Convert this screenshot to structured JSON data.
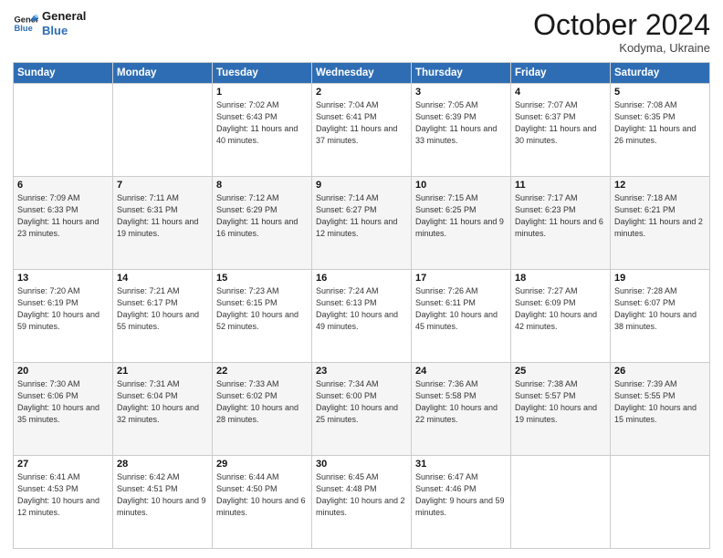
{
  "header": {
    "logo_line1": "General",
    "logo_line2": "Blue",
    "month": "October 2024",
    "location": "Kodyma, Ukraine"
  },
  "weekdays": [
    "Sunday",
    "Monday",
    "Tuesday",
    "Wednesday",
    "Thursday",
    "Friday",
    "Saturday"
  ],
  "weeks": [
    [
      {
        "day": "",
        "info": ""
      },
      {
        "day": "",
        "info": ""
      },
      {
        "day": "1",
        "info": "Sunrise: 7:02 AM\nSunset: 6:43 PM\nDaylight: 11 hours and 40 minutes."
      },
      {
        "day": "2",
        "info": "Sunrise: 7:04 AM\nSunset: 6:41 PM\nDaylight: 11 hours and 37 minutes."
      },
      {
        "day": "3",
        "info": "Sunrise: 7:05 AM\nSunset: 6:39 PM\nDaylight: 11 hours and 33 minutes."
      },
      {
        "day": "4",
        "info": "Sunrise: 7:07 AM\nSunset: 6:37 PM\nDaylight: 11 hours and 30 minutes."
      },
      {
        "day": "5",
        "info": "Sunrise: 7:08 AM\nSunset: 6:35 PM\nDaylight: 11 hours and 26 minutes."
      }
    ],
    [
      {
        "day": "6",
        "info": "Sunrise: 7:09 AM\nSunset: 6:33 PM\nDaylight: 11 hours and 23 minutes."
      },
      {
        "day": "7",
        "info": "Sunrise: 7:11 AM\nSunset: 6:31 PM\nDaylight: 11 hours and 19 minutes."
      },
      {
        "day": "8",
        "info": "Sunrise: 7:12 AM\nSunset: 6:29 PM\nDaylight: 11 hours and 16 minutes."
      },
      {
        "day": "9",
        "info": "Sunrise: 7:14 AM\nSunset: 6:27 PM\nDaylight: 11 hours and 12 minutes."
      },
      {
        "day": "10",
        "info": "Sunrise: 7:15 AM\nSunset: 6:25 PM\nDaylight: 11 hours and 9 minutes."
      },
      {
        "day": "11",
        "info": "Sunrise: 7:17 AM\nSunset: 6:23 PM\nDaylight: 11 hours and 6 minutes."
      },
      {
        "day": "12",
        "info": "Sunrise: 7:18 AM\nSunset: 6:21 PM\nDaylight: 11 hours and 2 minutes."
      }
    ],
    [
      {
        "day": "13",
        "info": "Sunrise: 7:20 AM\nSunset: 6:19 PM\nDaylight: 10 hours and 59 minutes."
      },
      {
        "day": "14",
        "info": "Sunrise: 7:21 AM\nSunset: 6:17 PM\nDaylight: 10 hours and 55 minutes."
      },
      {
        "day": "15",
        "info": "Sunrise: 7:23 AM\nSunset: 6:15 PM\nDaylight: 10 hours and 52 minutes."
      },
      {
        "day": "16",
        "info": "Sunrise: 7:24 AM\nSunset: 6:13 PM\nDaylight: 10 hours and 49 minutes."
      },
      {
        "day": "17",
        "info": "Sunrise: 7:26 AM\nSunset: 6:11 PM\nDaylight: 10 hours and 45 minutes."
      },
      {
        "day": "18",
        "info": "Sunrise: 7:27 AM\nSunset: 6:09 PM\nDaylight: 10 hours and 42 minutes."
      },
      {
        "day": "19",
        "info": "Sunrise: 7:28 AM\nSunset: 6:07 PM\nDaylight: 10 hours and 38 minutes."
      }
    ],
    [
      {
        "day": "20",
        "info": "Sunrise: 7:30 AM\nSunset: 6:06 PM\nDaylight: 10 hours and 35 minutes."
      },
      {
        "day": "21",
        "info": "Sunrise: 7:31 AM\nSunset: 6:04 PM\nDaylight: 10 hours and 32 minutes."
      },
      {
        "day": "22",
        "info": "Sunrise: 7:33 AM\nSunset: 6:02 PM\nDaylight: 10 hours and 28 minutes."
      },
      {
        "day": "23",
        "info": "Sunrise: 7:34 AM\nSunset: 6:00 PM\nDaylight: 10 hours and 25 minutes."
      },
      {
        "day": "24",
        "info": "Sunrise: 7:36 AM\nSunset: 5:58 PM\nDaylight: 10 hours and 22 minutes."
      },
      {
        "day": "25",
        "info": "Sunrise: 7:38 AM\nSunset: 5:57 PM\nDaylight: 10 hours and 19 minutes."
      },
      {
        "day": "26",
        "info": "Sunrise: 7:39 AM\nSunset: 5:55 PM\nDaylight: 10 hours and 15 minutes."
      }
    ],
    [
      {
        "day": "27",
        "info": "Sunrise: 6:41 AM\nSunset: 4:53 PM\nDaylight: 10 hours and 12 minutes."
      },
      {
        "day": "28",
        "info": "Sunrise: 6:42 AM\nSunset: 4:51 PM\nDaylight: 10 hours and 9 minutes."
      },
      {
        "day": "29",
        "info": "Sunrise: 6:44 AM\nSunset: 4:50 PM\nDaylight: 10 hours and 6 minutes."
      },
      {
        "day": "30",
        "info": "Sunrise: 6:45 AM\nSunset: 4:48 PM\nDaylight: 10 hours and 2 minutes."
      },
      {
        "day": "31",
        "info": "Sunrise: 6:47 AM\nSunset: 4:46 PM\nDaylight: 9 hours and 59 minutes."
      },
      {
        "day": "",
        "info": ""
      },
      {
        "day": "",
        "info": ""
      }
    ]
  ]
}
